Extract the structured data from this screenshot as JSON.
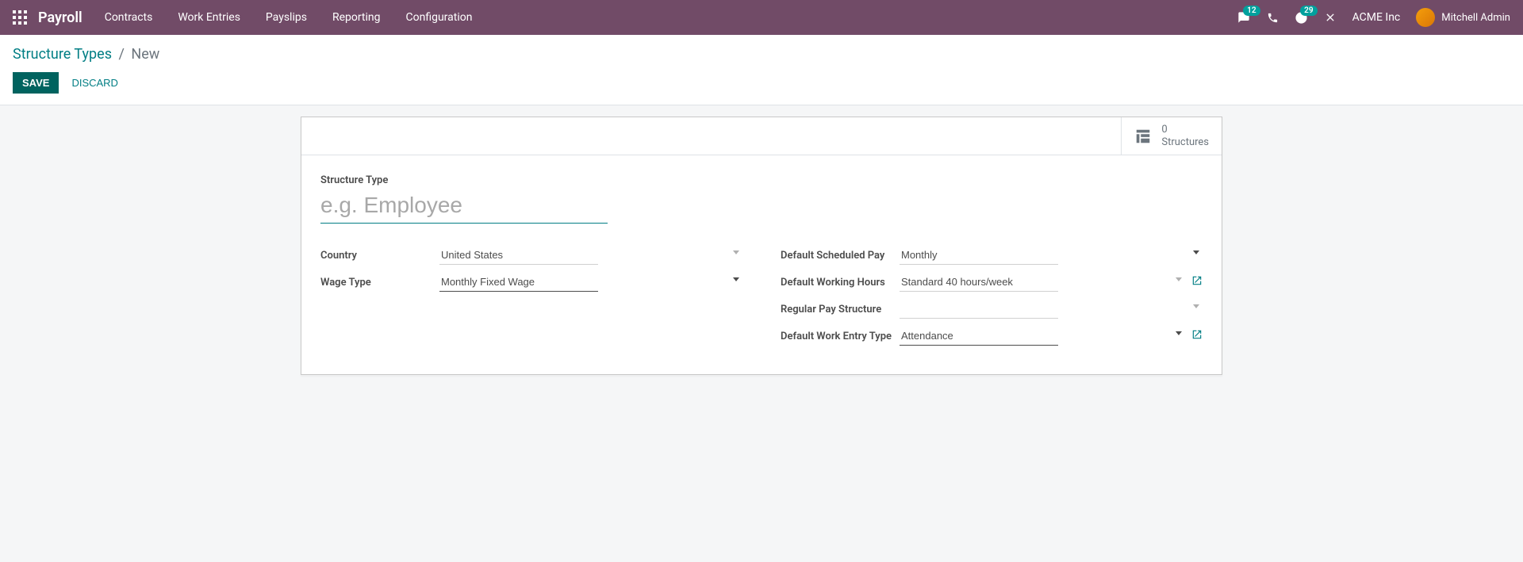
{
  "nav": {
    "brand": "Payroll",
    "items": [
      "Contracts",
      "Work Entries",
      "Payslips",
      "Reporting",
      "Configuration"
    ],
    "msg_count": "12",
    "clock_count": "29",
    "company": "ACME Inc",
    "user": "Mitchell Admin"
  },
  "breadcrumb": {
    "parent": "Structure Types",
    "current": "New"
  },
  "buttons": {
    "save": "SAVE",
    "discard": "DISCARD"
  },
  "stat": {
    "count": "0",
    "label": "Structures"
  },
  "form": {
    "title_label": "Structure Type",
    "title_placeholder": "e.g. Employee",
    "title_value": "",
    "left": {
      "country_label": "Country",
      "country_value": "United States",
      "wage_type_label": "Wage Type",
      "wage_type_value": "Monthly Fixed Wage"
    },
    "right": {
      "schedule_pay_label": "Default Scheduled Pay",
      "schedule_pay_value": "Monthly",
      "working_hours_label": "Default Working Hours",
      "working_hours_value": "Standard 40 hours/week",
      "regular_pay_label": "Regular Pay Structure",
      "regular_pay_value": "",
      "work_entry_type_label": "Default Work Entry Type",
      "work_entry_type_value": "Attendance"
    }
  }
}
